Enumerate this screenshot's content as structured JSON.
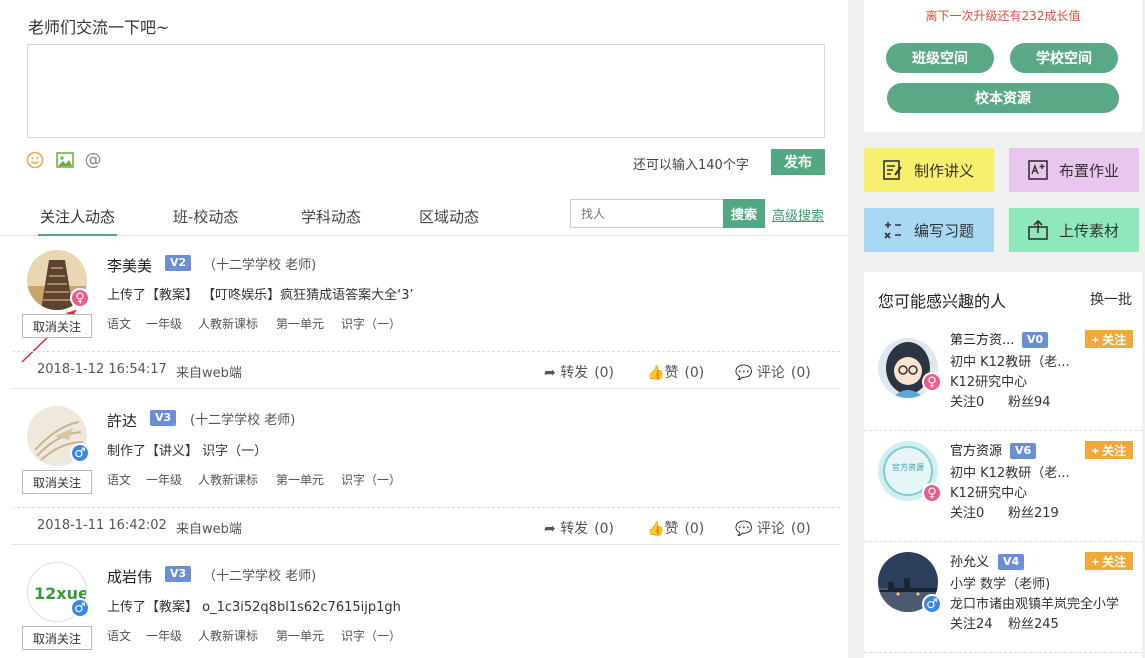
{
  "composer": {
    "title": "老师们交流一下吧~",
    "placeholder": "",
    "char_count": "还可以输入140个字",
    "publish_label": "发布",
    "tool_icons": [
      "smiley-icon",
      "image-icon",
      "at-icon"
    ]
  },
  "tabs": [
    {
      "label": "关注人动态",
      "active": true
    },
    {
      "label": "班-校动态",
      "active": false
    },
    {
      "label": "学科动态",
      "active": false
    },
    {
      "label": "区域动态",
      "active": false
    }
  ],
  "search": {
    "placeholder": "找人",
    "button_label": "搜索",
    "advanced_label": "高级搜索"
  },
  "posts": [
    {
      "name": "李美美",
      "level": "V2",
      "school": "（十二学学校 老师)",
      "gender": "♀",
      "text": "上传了【教案】 【叮咚娱乐】疯狂猜成语答案大全‘3’",
      "tags": [
        "语文",
        "一年级",
        "人教新课标",
        "第一单元",
        "识字（一）"
      ],
      "unfollow_label": "取消关注",
      "time": "2018-1-12 16:54:17",
      "source": "来自web端",
      "forward": "转发",
      "forward_count": "(0)",
      "like": "赞",
      "like_count": "(0)",
      "comment": "评论",
      "comment_count": "(0)"
    },
    {
      "name": "許达",
      "level": "V3",
      "school": "(十二学学校 老师)",
      "gender": "♂",
      "text": "制作了【讲义】 识字（一）",
      "tags": [
        "语文",
        "一年级",
        "人教新课标",
        "第一单元",
        "识字（一）"
      ],
      "unfollow_label": "取消关注",
      "time": "2018-1-11 16:42:02",
      "source": "来自web端",
      "forward": "转发",
      "forward_count": "(0)",
      "like": "赞",
      "like_count": "(0)",
      "comment": "评论",
      "comment_count": "(0)"
    },
    {
      "name": "成岩伟",
      "level": "V3",
      "school": "（十二学学校 老师)",
      "gender": "♂",
      "text": "上传了【教案】 o_1c3i52q8bl1s62c7615ijp1gh",
      "tags": [
        "语文",
        "一年级",
        "人教新课标",
        "第一单元",
        "识字（一）"
      ],
      "unfollow_label": "取消关注",
      "avatar_text": "12xue"
    }
  ],
  "sidebar": {
    "upgrade_text": "离下一次升级还有232成长值",
    "class_space": "班级空间",
    "school_space": "学校空间",
    "school_resource": "校本资源",
    "tools": [
      {
        "label": "制作讲义",
        "color": "#f7ef6e",
        "icon": "edit-doc-icon"
      },
      {
        "label": "布置作业",
        "color": "#e9c6ee",
        "icon": "homework-icon"
      },
      {
        "label": "编写习题",
        "color": "#a9d8f5",
        "icon": "math-icon"
      },
      {
        "label": "上传素材",
        "color": "#8ee8bb",
        "icon": "upload-icon"
      }
    ],
    "rec_title": "您可能感兴趣的人",
    "rec_refresh": "换一批",
    "follow_label": "+ 关注",
    "people": [
      {
        "name": "第三方资...",
        "level": "V0",
        "gender": "♀",
        "line1": "初中  K12教研（老...",
        "line2": "K12研究中心",
        "follow": "关注0",
        "fans": "粉丝94"
      },
      {
        "name": "官方资源",
        "level": "V6",
        "gender": "♀",
        "line1": "初中  K12教研（老...",
        "line2": "K12研究中心",
        "follow": "关注0",
        "fans": "粉丝219",
        "avatar_text": "官方资源"
      },
      {
        "name": "孙允义",
        "level": "V4",
        "gender": "♂",
        "line1": "小学  数学（老师)",
        "line2": "龙口市诸由观镇羊岚完全小学",
        "follow": "关注24",
        "fans": "粉丝245"
      }
    ]
  },
  "colors": {
    "accent_green": "#52a882",
    "female": "#ec5a8c",
    "male": "#3b86e8",
    "badge_blue": "#6b8fd6",
    "follow_orange": "#f0a83b",
    "upgrade_red": "#e64a3a"
  }
}
